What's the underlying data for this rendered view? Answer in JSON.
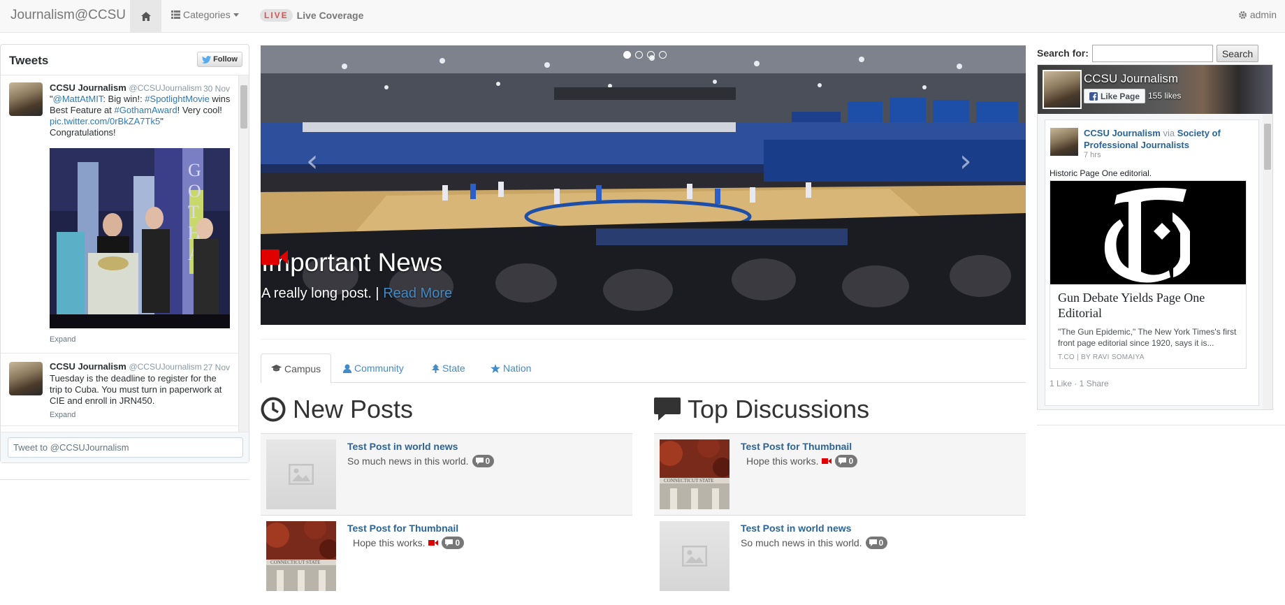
{
  "navbar": {
    "brand": "Journalism@CCSU",
    "home_icon": "home-icon",
    "categories_label": "Categories",
    "live_badge": "LIVE",
    "live_label": "Live Coverage",
    "admin_label": "admin"
  },
  "twitter": {
    "title": "Tweets",
    "follow_label": "Follow",
    "tweets": [
      {
        "name": "CCSU Journalism",
        "handle": "@CCSUJournalism",
        "date": "30 Nov",
        "text_parts": [
          "\"",
          "@MattAtMIT",
          ": Big win!: ",
          "#SpotlightMovie",
          " wins Best Feature at ",
          "#GothamAward",
          "! Very cool! ",
          "pic.twitter.com/0rBkZA7Tk5",
          "\" Congratulations!"
        ],
        "expand": "Expand"
      },
      {
        "name": "CCSU Journalism",
        "handle": "@CCSUJournalism",
        "date": "27 Nov",
        "text": "Tuesday is the deadline to register for the trip to Cuba. You must turn in paperwork at CIE and enroll in JRN450.",
        "expand": "Expand"
      }
    ],
    "tweet_box_placeholder": "Tweet to @CCSUJournalism"
  },
  "carousel": {
    "title": "Important News",
    "subtitle": "A really long post. |",
    "read_more": "Read More",
    "slide_count": 4,
    "active_slide": 1
  },
  "tabs": [
    {
      "label": "Campus",
      "icon": "graduation-cap-icon",
      "active": true
    },
    {
      "label": "Community",
      "icon": "user-icon",
      "active": false
    },
    {
      "label": "State",
      "icon": "tree-icon",
      "active": false
    },
    {
      "label": "Nation",
      "icon": "star-icon",
      "active": false
    }
  ],
  "new_posts": {
    "heading": "New Posts",
    "items": [
      {
        "title": "Test Post in world news",
        "desc": "So much news in this world.",
        "comments": "0",
        "video": false,
        "thumb": "placeholder"
      },
      {
        "title": "Test Post for Thumbnail",
        "desc": "Hope this works.",
        "comments": "0",
        "video": true,
        "thumb": "building"
      }
    ]
  },
  "top_discussions": {
    "heading": "Top Discussions",
    "items": [
      {
        "title": "Test Post for Thumbnail",
        "desc": "Hope this works.",
        "comments": "0",
        "video": true,
        "thumb": "building"
      },
      {
        "title": "Test Post in world news",
        "desc": "So much news in this world.",
        "comments": "0",
        "video": false,
        "thumb": "placeholder"
      }
    ]
  },
  "search": {
    "label": "Search for:",
    "value": "",
    "button": "Search"
  },
  "facebook": {
    "page_name": "CCSU Journalism",
    "like_label": "Like Page",
    "likes": "155 likes",
    "post_author": "CCSU Journalism",
    "post_via": "via",
    "post_source": "Society of Professional Journalists",
    "post_time": "7 hrs",
    "post_text": "Historic Page One editorial.",
    "card_title": "Gun Debate Yields Page One Editorial",
    "card_desc": "\"The Gun Epidemic,\" The New York Times's first front page editorial since 1920, says it is...",
    "card_source": "T.CO  |  BY RAVI SOMAIYA",
    "stats": "1 Like · 1 Share"
  }
}
